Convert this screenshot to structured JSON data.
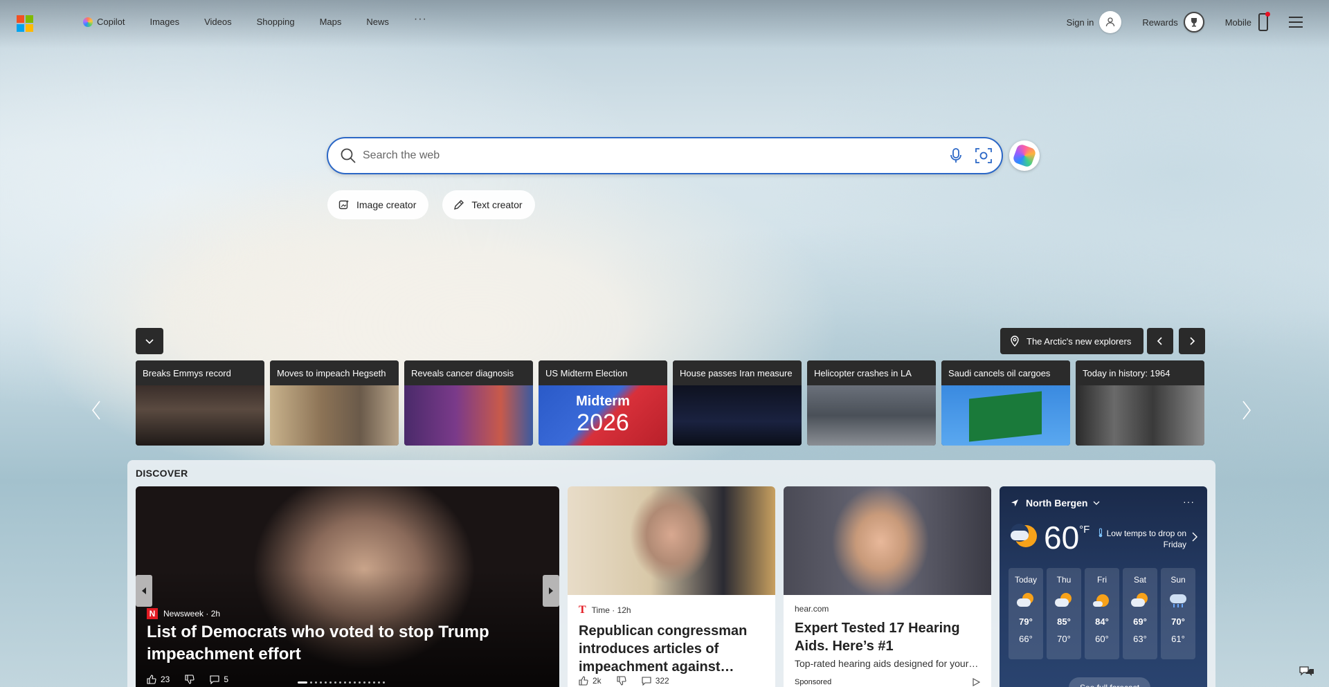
{
  "header": {
    "nav": [
      {
        "label": "Copilot"
      },
      {
        "label": "Images"
      },
      {
        "label": "Videos"
      },
      {
        "label": "Shopping"
      },
      {
        "label": "Maps"
      },
      {
        "label": "News"
      }
    ],
    "more": "···",
    "sign_in": "Sign in",
    "rewards": "Rewards",
    "mobile": "Mobile"
  },
  "search": {
    "placeholder": "Search the web",
    "chips": [
      {
        "label": "Image creator"
      },
      {
        "label": "Text creator"
      }
    ]
  },
  "carousel": {
    "location_label": "The Arctic's new explorers",
    "cards": [
      {
        "title": "Breaks Emmys record"
      },
      {
        "title": "Moves to impeach Hegseth"
      },
      {
        "title": "Reveals cancer diagnosis"
      },
      {
        "title": "US Midterm Election",
        "overlay_top": "Midterm",
        "overlay_bottom": "2026"
      },
      {
        "title": "House passes Iran measure"
      },
      {
        "title": "Helicopter crashes in LA"
      },
      {
        "title": "Saudi cancels oil cargoes"
      },
      {
        "title": "Today in history: 1964"
      }
    ]
  },
  "discover": {
    "label": "DISCOVER",
    "hero": {
      "source": "Newsweek",
      "age": "2h",
      "title": "List of Democrats who voted to stop Trump impeachment effort",
      "likes": "23",
      "comments": "5"
    },
    "card1": {
      "source": "Time",
      "age": "12h",
      "title": "Republican congressman introduces articles of impeachment against…",
      "likes": "2k",
      "comments": "322"
    },
    "card2": {
      "source": "hear.com",
      "title": "Expert Tested 17 Hearing Aids. Here’s #1",
      "desc": "Top-rated hearing aids designed for your…",
      "sponsored": "Sponsored"
    }
  },
  "weather": {
    "location": "North Bergen",
    "more": "···",
    "temp": "60",
    "unit": "°F",
    "alert": "Low temps to drop on Friday",
    "days": [
      {
        "name": "Today",
        "hi": "79°",
        "lo": "66°",
        "icon": "partly-cloudy-sun-icon"
      },
      {
        "name": "Thu",
        "hi": "85°",
        "lo": "70°",
        "icon": "partly-cloudy-sun-icon"
      },
      {
        "name": "Fri",
        "hi": "84°",
        "lo": "60°",
        "icon": "partly-cloudy-sun-icon"
      },
      {
        "name": "Sat",
        "hi": "69°",
        "lo": "63°",
        "icon": "partly-cloudy-sun-icon"
      },
      {
        "name": "Sun",
        "hi": "70°",
        "lo": "61°",
        "icon": "rain-cloud-icon"
      }
    ],
    "forecast_link": "See full forecast"
  },
  "colors": {
    "search_border": "#2b67c6",
    "weather_bg": "#243a62",
    "newsweek_red": "#e31b23"
  }
}
